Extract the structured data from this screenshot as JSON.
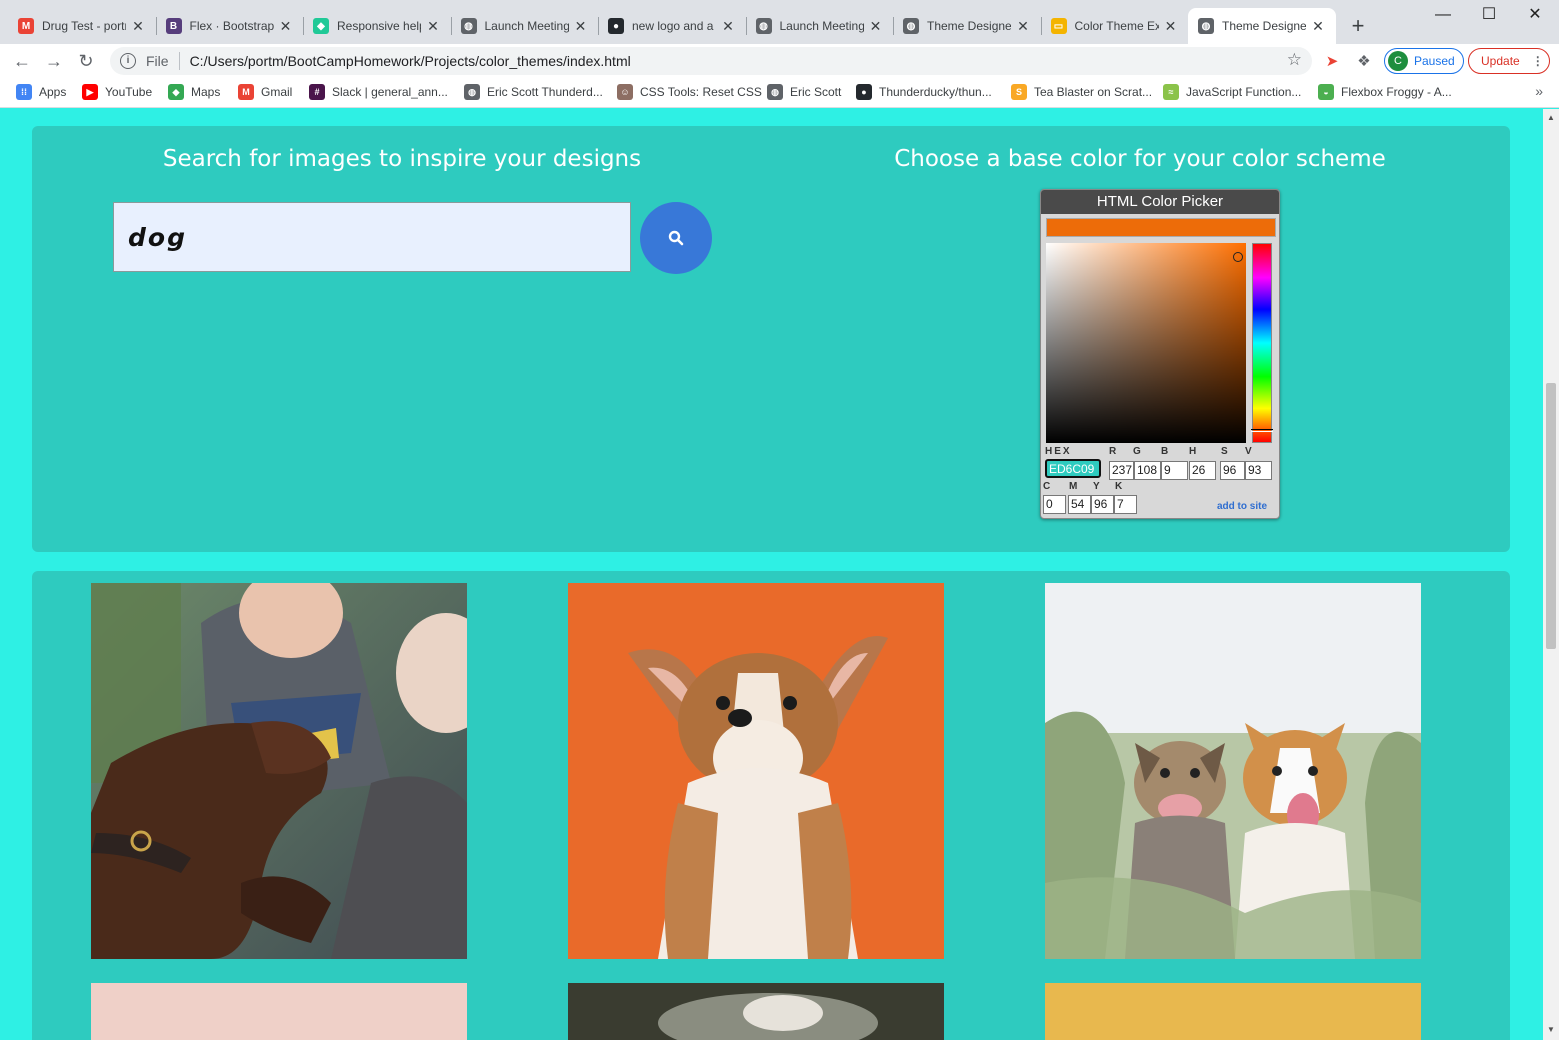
{
  "browser": {
    "tabs": [
      {
        "title": "Drug Test - portm",
        "icon": "gmail-icon",
        "color": "#ea4335",
        "glyph": "M"
      },
      {
        "title": "Flex · Bootstrap",
        "icon": "bootstrap-icon",
        "color": "#563d7c",
        "glyph": "B"
      },
      {
        "title": "Responsive help",
        "icon": "codepen-icon",
        "color": "#20c997",
        "glyph": "◆"
      },
      {
        "title": "Launch Meeting",
        "icon": "globe-icon",
        "color": "#5f6368",
        "glyph": "◍"
      },
      {
        "title": "new logo and a",
        "icon": "github-icon",
        "color": "#24292e",
        "glyph": "●"
      },
      {
        "title": "Launch Meeting",
        "icon": "globe-icon",
        "color": "#5f6368",
        "glyph": "◍"
      },
      {
        "title": "Theme Designer",
        "icon": "globe-icon",
        "color": "#5f6368",
        "glyph": "◍"
      },
      {
        "title": "Color Theme Ex",
        "icon": "slides-icon",
        "color": "#f4b400",
        "glyph": "▭"
      },
      {
        "title": "Theme Designer",
        "icon": "globe-icon",
        "color": "#5f6368",
        "glyph": "◍"
      }
    ],
    "active_tab_index": 8,
    "address": {
      "scheme_label": "File",
      "url": "C:/Users/portm/BootCampHomework/Projects/color_themes/index.html"
    },
    "profile": {
      "initial": "C",
      "status": "Paused"
    },
    "update_label": "Update",
    "bookmarks": [
      {
        "label": "Apps",
        "icon": "apps-grid-icon",
        "color": "#4285f4",
        "glyph": "⁞⁞"
      },
      {
        "label": "YouTube",
        "icon": "youtube-icon",
        "color": "#ff0000",
        "glyph": "▶"
      },
      {
        "label": "Maps",
        "icon": "maps-icon",
        "color": "#34a853",
        "glyph": "◆"
      },
      {
        "label": "Gmail",
        "icon": "gmail-icon",
        "color": "#ea4335",
        "glyph": "M"
      },
      {
        "label": "Slack | general_ann...",
        "icon": "slack-icon",
        "color": "#4a154b",
        "glyph": "#"
      },
      {
        "label": "Eric Scott Thunderd...",
        "icon": "globe-icon",
        "color": "#5f6368",
        "glyph": "◍"
      },
      {
        "label": "CSS Tools: Reset CSS",
        "icon": "css-tools-icon",
        "color": "#8d6e63",
        "glyph": "☺"
      },
      {
        "label": "Eric Scott",
        "icon": "globe-icon",
        "color": "#5f6368",
        "glyph": "◍"
      },
      {
        "label": "Thunderducky/thun...",
        "icon": "github-icon",
        "color": "#24292e",
        "glyph": "●"
      },
      {
        "label": "Tea Blaster on Scrat...",
        "icon": "scratch-icon",
        "color": "#f9a825",
        "glyph": "S"
      },
      {
        "label": "JavaScript Function...",
        "icon": "js-icon",
        "color": "#8bc34a",
        "glyph": "≈"
      },
      {
        "label": "Flexbox Froggy - A...",
        "icon": "froggy-icon",
        "color": "#4caf50",
        "glyph": "◒"
      }
    ]
  },
  "page": {
    "search_heading": "Search for images to inspire your designs",
    "color_heading": "Choose a base color for your color scheme",
    "search_value": "dog",
    "colors": {
      "page_background": "#2ef0e4",
      "card_background": "#2ecbbf",
      "search_button": "#3878d8",
      "picked_color": "#ED6C09"
    }
  },
  "color_picker": {
    "title": "HTML Color Picker",
    "labels": {
      "hex": "HEX",
      "r": "R",
      "g": "G",
      "b": "B",
      "h": "H",
      "s": "S",
      "v": "V",
      "c": "C",
      "m": "M",
      "y": "Y",
      "k": "K"
    },
    "values": {
      "hex": "ED6C09",
      "r": "237",
      "g": "108",
      "b": "9",
      "h": "26",
      "s": "96",
      "v": "93",
      "c": "0",
      "m": "54",
      "y": "96",
      "k": "7"
    },
    "hue_base": "#ff6f00",
    "hue_level": 0.93,
    "add_to_site_label": "add to site"
  },
  "results": [
    {
      "name": "dog-photo-1",
      "description": "brown labrador with elderly couple"
    },
    {
      "name": "dog-photo-2",
      "description": "corgi puppy on orange background"
    },
    {
      "name": "dog-photo-3",
      "description": "two dogs in tall grass"
    },
    {
      "name": "dog-photo-4",
      "description": "pink background photo"
    },
    {
      "name": "dog-photo-5",
      "description": "dark outdoor photo"
    },
    {
      "name": "dog-photo-6",
      "description": "yellow background photo"
    }
  ]
}
